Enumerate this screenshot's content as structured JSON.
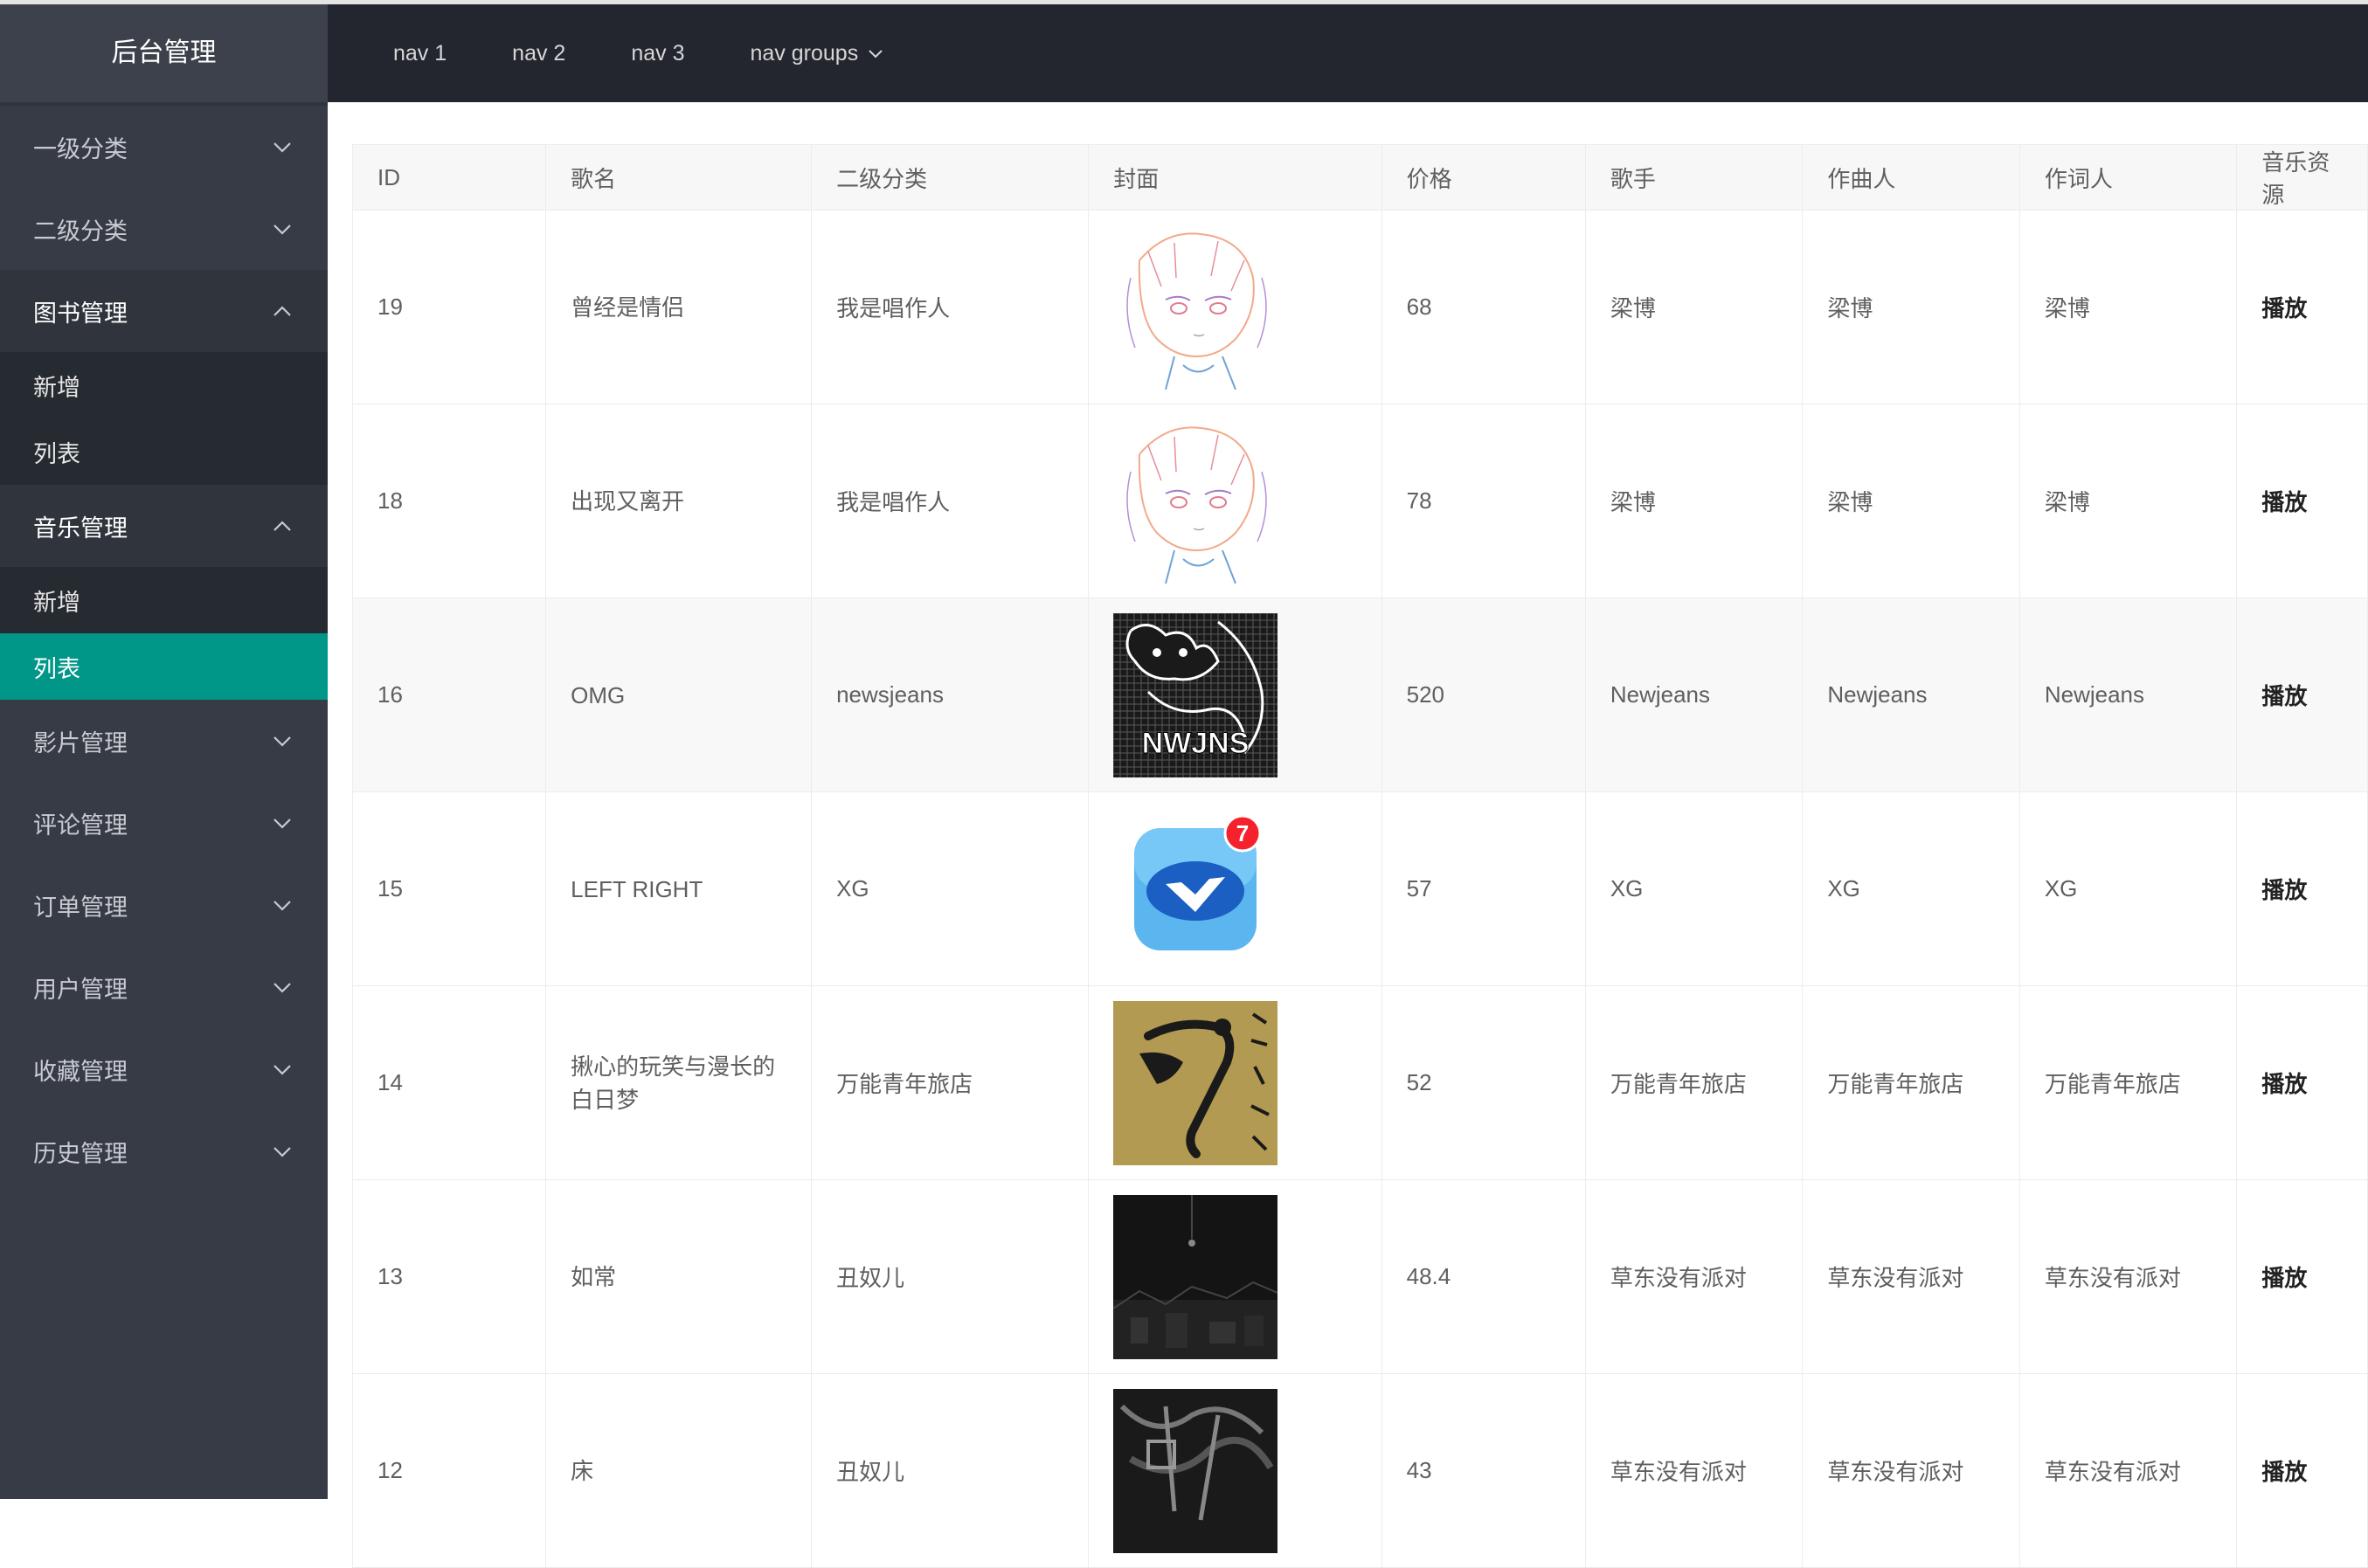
{
  "app": {
    "title": "后台管理"
  },
  "header": {
    "nav": [
      "nav 1",
      "nav 2",
      "nav 3",
      "nav groups"
    ]
  },
  "sidebar": {
    "menus": [
      {
        "label": "一级分类",
        "open": false
      },
      {
        "label": "二级分类",
        "open": false
      },
      {
        "label": "图书管理",
        "open": true,
        "children": [
          "新增",
          "列表"
        ]
      },
      {
        "label": "音乐管理",
        "open": true,
        "children": [
          "新增",
          "列表"
        ],
        "active_child": "列表"
      },
      {
        "label": "影片管理",
        "open": false
      },
      {
        "label": "评论管理",
        "open": false
      },
      {
        "label": "订单管理",
        "open": false
      },
      {
        "label": "用户管理",
        "open": false
      },
      {
        "label": "收藏管理",
        "open": false
      },
      {
        "label": "历史管理",
        "open": false
      }
    ]
  },
  "table": {
    "columns": [
      "ID",
      "歌名",
      "二级分类",
      "封面",
      "价格",
      "歌手",
      "作曲人",
      "作词人",
      "音乐资源"
    ],
    "rows": [
      {
        "id": "19",
        "name": "曾经是情侣",
        "category": "我是唱作人",
        "cover": "anime-sketch",
        "price": "68",
        "singer": "梁博",
        "composer": "梁博",
        "lyricist": "梁博",
        "resource": "播放"
      },
      {
        "id": "18",
        "name": "出现又离开",
        "category": "我是唱作人",
        "cover": "anime-sketch",
        "price": "78",
        "singer": "梁博",
        "composer": "梁博",
        "lyricist": "梁博",
        "resource": "播放"
      },
      {
        "id": "16",
        "name": "OMG",
        "category": "newsjeans",
        "cover": "newjeans-bunny",
        "price": "520",
        "singer": "Newjeans",
        "composer": "Newjeans",
        "lyricist": "Newjeans",
        "resource": "播放"
      },
      {
        "id": "15",
        "name": "LEFT RIGHT",
        "category": "XG",
        "cover": "xg-app-icon",
        "badge": "7",
        "price": "57",
        "singer": "XG",
        "composer": "XG",
        "lyricist": "XG",
        "resource": "播放"
      },
      {
        "id": "14",
        "name": "揪心的玩笑与漫长的白日梦",
        "category": "万能青年旅店",
        "cover": "gold-figure",
        "price": "52",
        "singer": "万能青年旅店",
        "composer": "万能青年旅店",
        "lyricist": "万能青年旅店",
        "resource": "播放"
      },
      {
        "id": "13",
        "name": "如常",
        "category": "丑奴儿",
        "cover": "dark-city",
        "price": "48.4",
        "singer": "草东没有派对",
        "composer": "草东没有派对",
        "lyricist": "草东没有派对",
        "resource": "播放"
      },
      {
        "id": "12",
        "name": "床",
        "category": "丑奴儿",
        "cover": "dark-abstract",
        "price": "43",
        "singer": "草东没有派对",
        "composer": "草东没有派对",
        "lyricist": "草东没有派对",
        "resource": "播放"
      }
    ]
  },
  "colors": {
    "sidebar_bg": "#363b46",
    "header_bg": "#23262e",
    "submenu_bg": "#262a31",
    "active": "#009688",
    "badge": "#f5222d"
  }
}
